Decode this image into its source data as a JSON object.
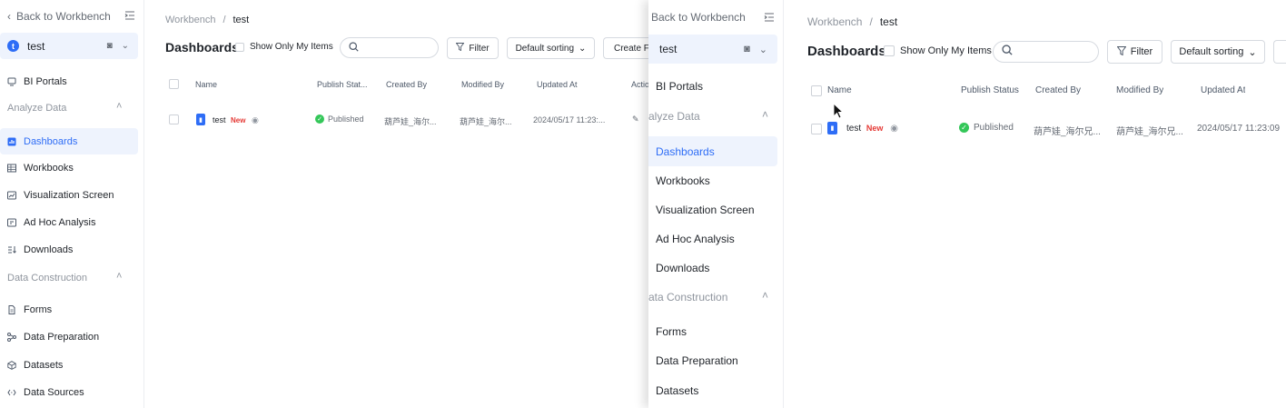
{
  "colors": {
    "accent": "#2e6df6",
    "active_bg": "#eef3fd",
    "new_badge": "#e53935",
    "published": "#34c759"
  },
  "sidebar": {
    "back_label": "Back to Workbench",
    "space": {
      "avatar_letter": "t",
      "name": "test"
    },
    "portals_label": "BI Portals",
    "group_analyze": "Analyze Data",
    "group_construction": "Data Construction",
    "items": {
      "dashboards": "Dashboards",
      "workbooks": "Workbooks",
      "visualization": "Visualization Screen",
      "adhoc": "Ad Hoc Analysis",
      "downloads": "Downloads",
      "forms": "Forms",
      "preparation": "Data Preparation",
      "datasets": "Datasets",
      "sources": "Data Sources"
    },
    "b_back_label": "Back to Workbench",
    "b_group_analyze": "alyze Data",
    "b_group_construction": "ata Construction"
  },
  "header": {
    "breadcrumb_root": "Workbench",
    "breadcrumb_sep": "/",
    "breadcrumb_current": "test",
    "title": "Dashboards"
  },
  "toolbar": {
    "only_mine": "Show Only My Items",
    "search_placeholder": "",
    "filter": "Filter",
    "sorting": "Default sorting",
    "create_truncated": "Create Fo"
  },
  "table_a": {
    "columns": {
      "name": "Name",
      "status": "Publish Stat...",
      "created": "Created By",
      "modified": "Modified By",
      "updated": "Updated At",
      "actions": "Actio"
    },
    "row": {
      "name": "test",
      "badge": "New",
      "status": "Published",
      "created": "葫芦娃_海尔...",
      "modified": "葫芦娃_海尔...",
      "updated": "2024/05/17 11:23:..."
    }
  },
  "table_b": {
    "columns": {
      "name": "Name",
      "status": "Publish Status",
      "created": "Created By",
      "modified": "Modified By",
      "updated": "Updated At"
    },
    "row": {
      "name": "test",
      "badge": "New",
      "status": "Published",
      "created": "葫芦娃_海尔兄...",
      "modified": "葫芦娃_海尔兄...",
      "updated": "2024/05/17 11:23:09"
    }
  }
}
